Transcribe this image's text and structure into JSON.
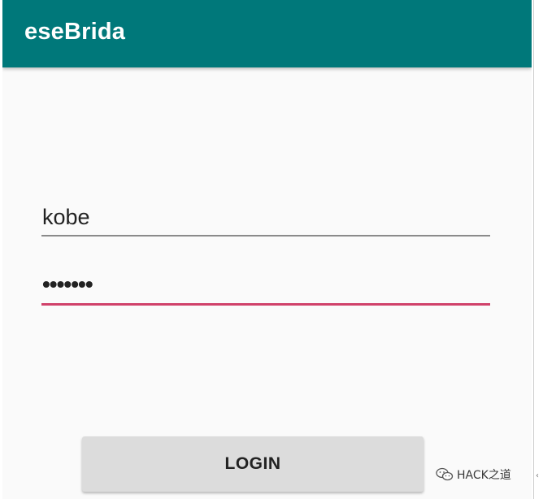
{
  "app": {
    "title": "eseBrida",
    "colors": {
      "app_bar": "#00787a",
      "accent_underline": "#d0416a",
      "background": "#fafafa",
      "button": "#dcdcdc"
    }
  },
  "form": {
    "username_value": "kobe",
    "password_value": "•••••••",
    "login_label": "LOGIN"
  },
  "watermark": {
    "text": "HACK之道",
    "icon": "wechat-icon"
  }
}
